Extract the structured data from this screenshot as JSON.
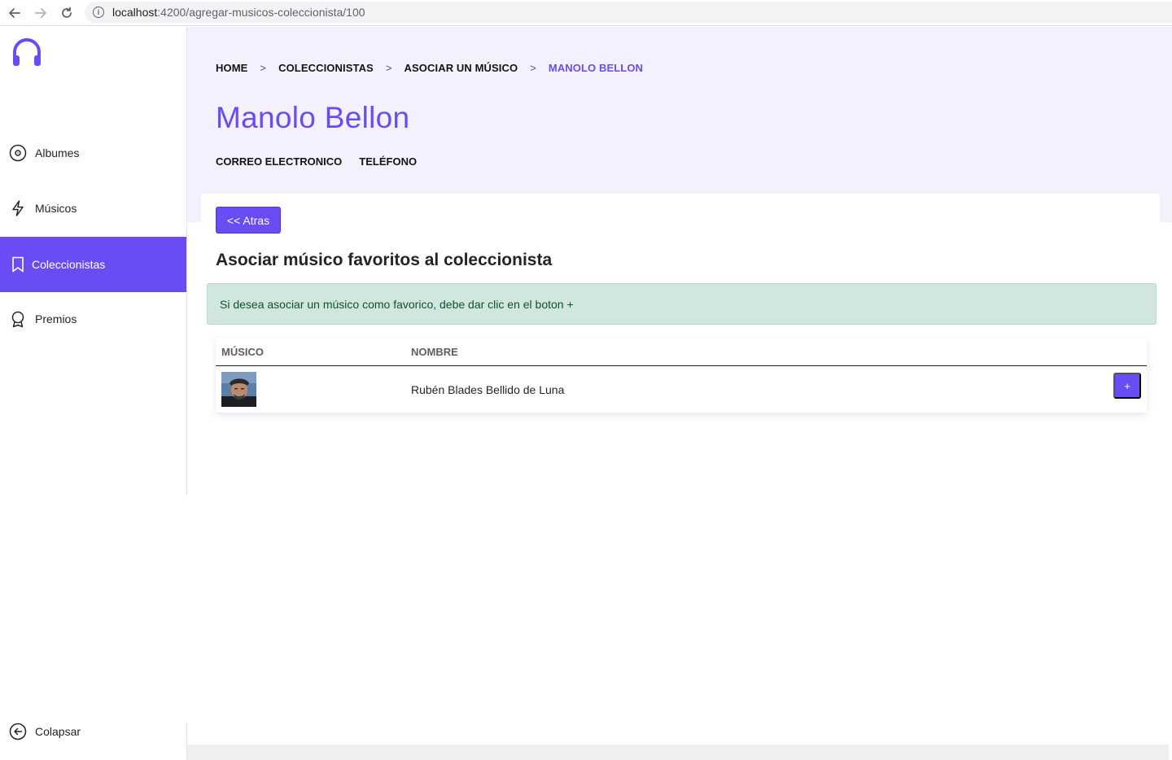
{
  "browser": {
    "url_host": "localhost",
    "url_path": ":4200/agregar-musicos-coleccionista/100"
  },
  "sidebar": {
    "logo": "headphones-icon",
    "items": [
      {
        "label": "Albumes",
        "icon": "disc-icon"
      },
      {
        "label": "Músicos",
        "icon": "lightning-icon"
      },
      {
        "label": "Coleccionistas",
        "icon": "bookmark-icon",
        "active": true
      },
      {
        "label": "Premios",
        "icon": "award-icon"
      }
    ],
    "collapse_label": "Colapsar"
  },
  "breadcrumb": {
    "items": [
      "HOME",
      "COLECCIONISTAS",
      "ASOCIAR UN MÚSICO",
      "MANOLO BELLON"
    ],
    "separator": ">"
  },
  "header": {
    "title": "Manolo Bellon",
    "email_label": "CORREO ELECTRONICO",
    "phone_label": "TELÉFONO"
  },
  "main": {
    "back_label": "<< Atras",
    "section_title": "Asociar músico favoritos al coleccionista",
    "alert_text": "Si desea asociar un músico como favorico, debe dar clic en el boton +",
    "table": {
      "columns": [
        "MÚSICO",
        "NOMBRE"
      ],
      "rows": [
        {
          "name": "Rubén Blades Bellido de Luna",
          "action": "+"
        }
      ]
    }
  },
  "colors": {
    "accent": "#6a4cf5",
    "header_bg": "#f4f1ff",
    "alert_bg": "#d1e7dd",
    "alert_text": "#0f5132"
  }
}
